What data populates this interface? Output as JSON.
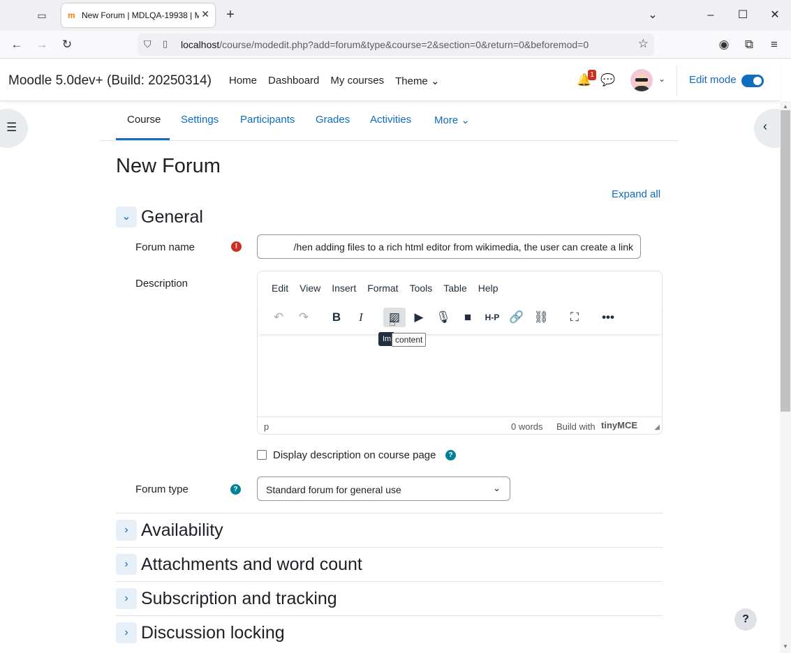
{
  "browser": {
    "tab_title": "New Forum | MDLQA-19938 | M",
    "url_host": "localhost",
    "url_path": "/course/modedit.php?add=forum&type&course=2&section=0&return=0&beforemod=0"
  },
  "header": {
    "brand": "Moodle 5.0dev+ (Build: 20250314)",
    "nav": [
      "Home",
      "Dashboard",
      "My courses",
      "Theme ⌄"
    ],
    "notification_count": "1",
    "edit_mode_label": "Edit mode"
  },
  "course_nav": {
    "items": [
      "Course",
      "Settings",
      "Participants",
      "Grades",
      "Activities",
      "More ⌄"
    ]
  },
  "page": {
    "title": "New Forum",
    "expand_all": "Expand all"
  },
  "general": {
    "title": "General",
    "forum_name_label": "Forum name",
    "forum_name_value": "/hen adding files to a rich html editor from wikimedia, the user can create a link",
    "description_label": "Description",
    "display_desc_label": "Display description on course page",
    "forum_type_label": "Forum type",
    "forum_type_value": "Standard forum for general use"
  },
  "editor": {
    "menu": [
      "Edit",
      "View",
      "Insert",
      "Format",
      "Tools",
      "Table",
      "Help"
    ],
    "status_path": "p",
    "word_count": "0 words",
    "build_with": "Build with",
    "brand": "tinyMCE",
    "tooltip_dark": "Im",
    "tooltip_light": "content"
  },
  "sections": [
    "Availability",
    "Attachments and word count",
    "Subscription and tracking",
    "Discussion locking"
  ],
  "colors": {
    "link": "#0f6cbf",
    "required": "#ca3120",
    "help": "#008196"
  }
}
